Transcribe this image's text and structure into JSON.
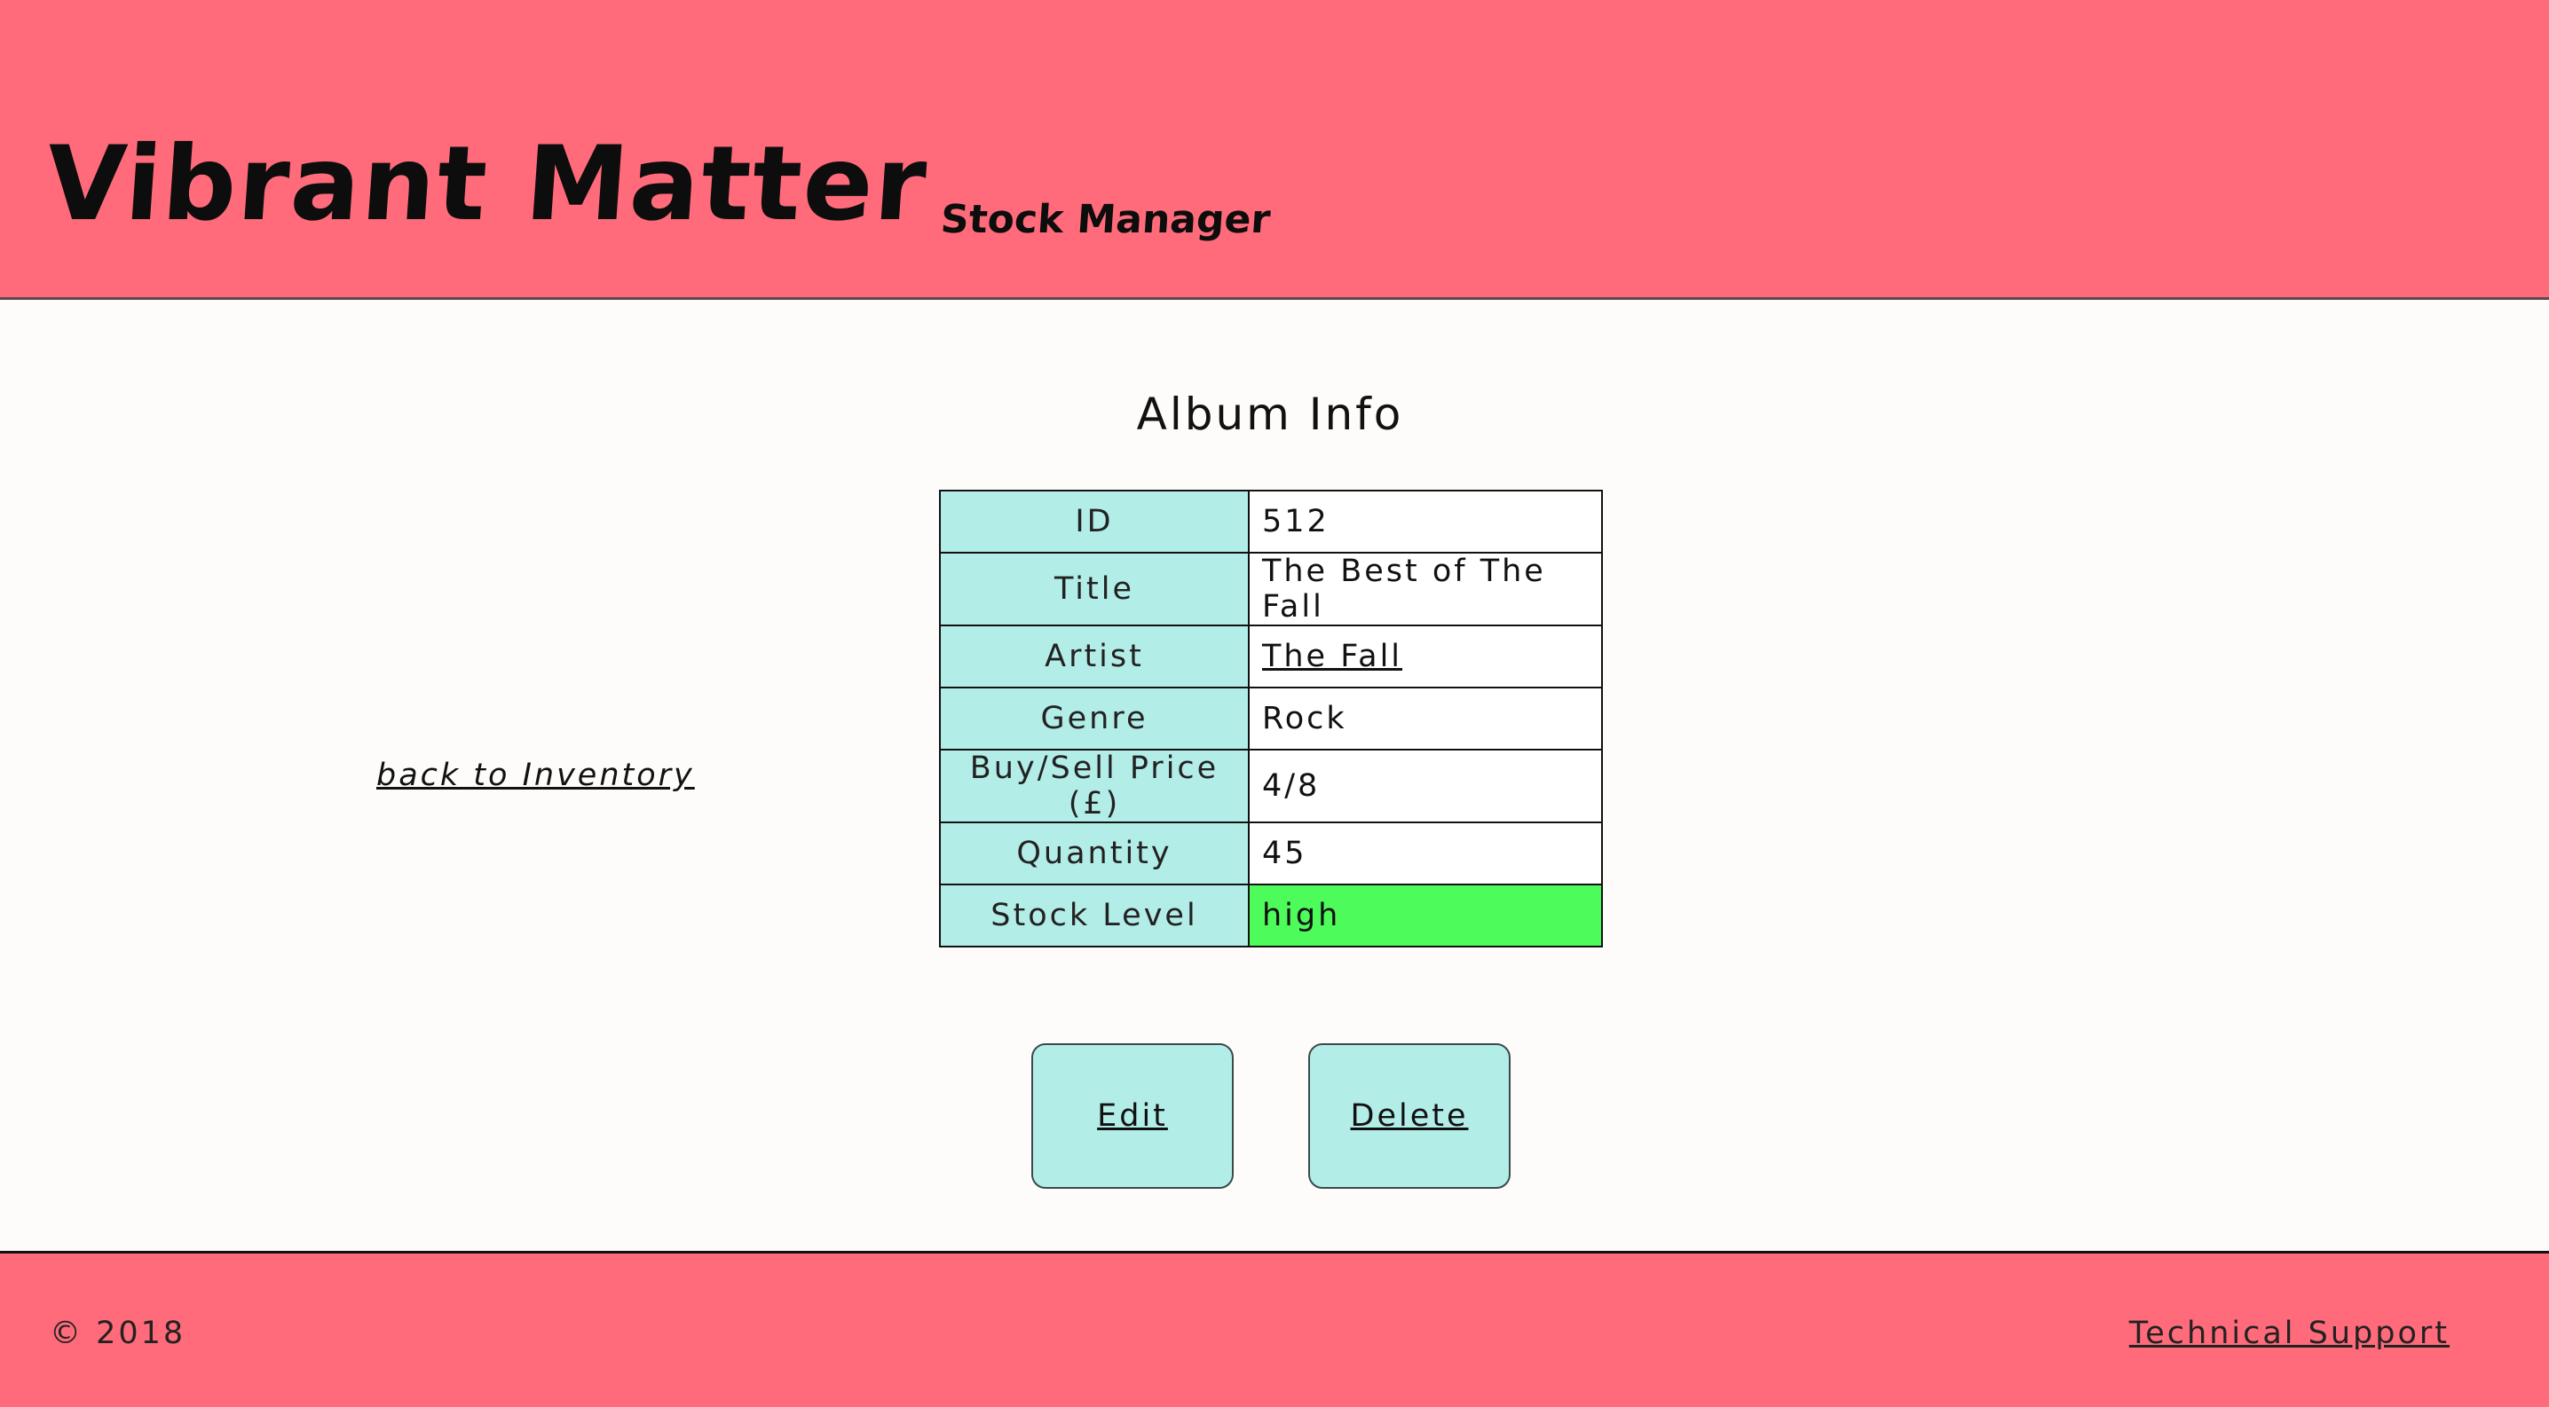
{
  "header": {
    "brand": "Vibrant Matter",
    "subtitle": "Stock Manager"
  },
  "main": {
    "heading": "Album Info",
    "back_link": "back to Inventory",
    "album": {
      "rows": [
        {
          "label": "ID",
          "value": "512"
        },
        {
          "label": "Title",
          "value": "The Best of The Fall"
        },
        {
          "label": "Artist",
          "value": "The Fall"
        },
        {
          "label": "Genre",
          "value": "Rock"
        },
        {
          "label": "Buy/Sell Price (£)",
          "value": "4/8"
        },
        {
          "label": "Quantity",
          "value": "45"
        },
        {
          "label": "Stock Level",
          "value": "high"
        }
      ]
    },
    "colors": {
      "header_bg": "#ff6b7a",
      "label_cell_bg": "#b3ede8",
      "stock_high_bg": "#4dfb5a"
    },
    "buttons": {
      "edit": "Edit",
      "delete": "Delete"
    }
  },
  "footer": {
    "copyright": "© 2018",
    "support_link": "Technical Support"
  }
}
